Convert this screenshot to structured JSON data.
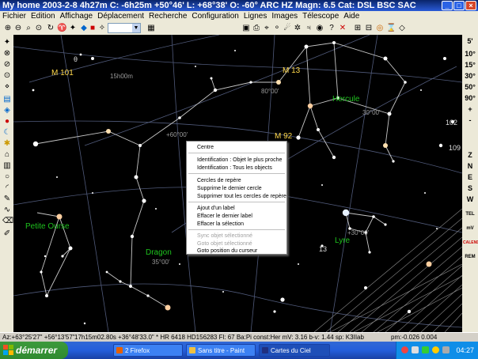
{
  "window": {
    "title": "My home 2003-2-8   4h27m C: -6h25m +50°46' L: +68°38' O: -60° ARC HZ  Magn: 6.5 Cat: DSL BSC SAC"
  },
  "menu": [
    "Fichier",
    "Edition",
    "Affichage",
    "Déplacement",
    "Recherche",
    "Configuration",
    "Lignes",
    "Images",
    "Télescope",
    "Aide"
  ],
  "toolbar_left": [
    "zoom-in",
    "zoom-out",
    "zoom-window",
    "zoom-fit",
    "rotate-left",
    "flip",
    "ecliptic",
    "color",
    "select",
    "star-filter",
    "galaxy-filter"
  ],
  "toolbar_right": [
    "disk-save",
    "print",
    "telescope",
    "satellite",
    "comet",
    "asteroid",
    "planet",
    "help",
    "close",
    "grid-a",
    "grid-b",
    "target",
    "hourglass",
    "diamond"
  ],
  "right_panel": [
    "5'",
    "10°",
    "15°",
    "30°",
    "50°",
    "90°",
    "+",
    "-",
    "Z",
    "N",
    "E",
    "S",
    "W",
    "TEL",
    "mV",
    "CALENDAR",
    "REM"
  ],
  "sky_labels": [
    {
      "text": "θ"
    },
    {
      "text": "M 101"
    },
    {
      "text": "M 13"
    },
    {
      "text": "Hercule"
    },
    {
      "text": "M 92"
    },
    {
      "text": "Petite Ourse"
    },
    {
      "text": "Dragon"
    },
    {
      "text": "Lyre"
    },
    {
      "text": "15h00m"
    },
    {
      "text": "+60°00'"
    },
    {
      "text": "80°00'"
    },
    {
      "text": "30°00'"
    },
    {
      "text": "+30°00'"
    },
    {
      "text": "35°00'"
    },
    {
      "text": "102"
    },
    {
      "text": "109"
    },
    {
      "text": "13"
    }
  ],
  "context_menu": {
    "items": [
      {
        "label": "Centre",
        "enabled": true
      },
      {
        "label": "Identification : Objet le plus proche",
        "enabled": true
      },
      {
        "label": "Identification : Tous les objects",
        "enabled": true
      },
      {
        "label": "Cercles de repère",
        "enabled": true
      },
      {
        "label": "Supprime le dernier cercle",
        "enabled": true
      },
      {
        "label": "Supprimer tout les cercles de repère",
        "enabled": true
      },
      {
        "label": "Ajout d'un label",
        "enabled": true
      },
      {
        "label": "Effacer le dernier label",
        "enabled": true
      },
      {
        "label": "Effacer la sélection",
        "enabled": true
      },
      {
        "label": "Sync objet sélectionné",
        "enabled": false
      },
      {
        "label": "Goto objet sélectionné",
        "enabled": false
      },
      {
        "label": "Goto position du curseur",
        "enabled": true
      }
    ]
  },
  "status": {
    "position": "Az:+63°25'27\" +56°13'57\"",
    "object": "17h15m02.80s +36°48'33.0\"  * HR 6418 HD156283 Fl: 67 Ba:Pi  const:Her mV: 3.16 b-v: 1.44 sp: K3IIab",
    "extra": "pm:-0.026 0.004"
  },
  "taskbar": {
    "start_label": "démarrer",
    "tasks": [
      {
        "label": "2 Firefox",
        "active": false
      },
      {
        "label": "Sans titre - Paint",
        "active": false
      },
      {
        "label": "Cartes du Ciel",
        "active": true
      }
    ],
    "clock": "04:27"
  },
  "colors": {
    "sky": "#000000",
    "constellation_line": "#c8c8c8",
    "grid_line": "#505a7a",
    "label_green": "#1ec31e",
    "label_yellow": "#ffd84a",
    "titlebar": "#0a246a"
  }
}
